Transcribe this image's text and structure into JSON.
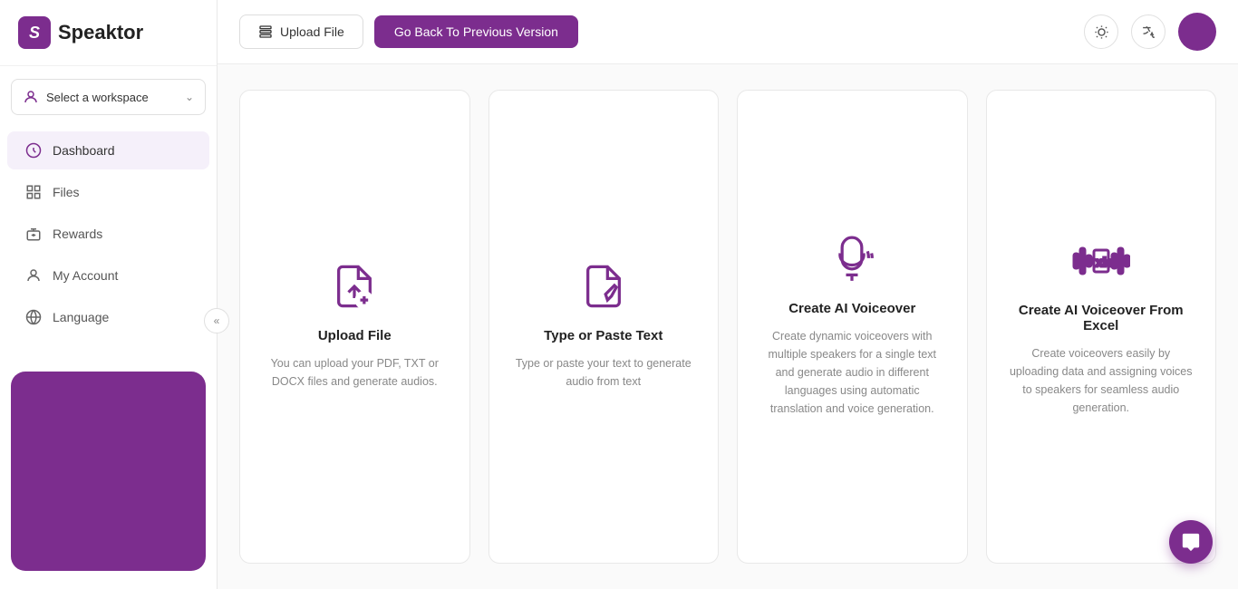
{
  "app": {
    "name": "Speaktor"
  },
  "sidebar": {
    "workspace_label": "Select a workspace",
    "nav_items": [
      {
        "id": "dashboard",
        "label": "Dashboard",
        "active": true
      },
      {
        "id": "files",
        "label": "Files",
        "active": false
      },
      {
        "id": "rewards",
        "label": "Rewards",
        "active": false
      },
      {
        "id": "my-account",
        "label": "My Account",
        "active": false
      },
      {
        "id": "language",
        "label": "Language",
        "active": false
      }
    ]
  },
  "topbar": {
    "upload_btn_label": "Upload File",
    "go_back_btn_label": "Go Back To Previous Version"
  },
  "cards": [
    {
      "id": "upload-file",
      "title": "Upload File",
      "desc": "You can upload your PDF, TXT or DOCX files and generate audios."
    },
    {
      "id": "type-paste-text",
      "title": "Type or Paste Text",
      "desc": "Type or paste your text to generate audio from text"
    },
    {
      "id": "create-ai-voiceover",
      "title": "Create AI Voiceover",
      "desc": "Create dynamic voiceovers with multiple speakers for a single text and generate audio in different languages using automatic translation and voice generation."
    },
    {
      "id": "create-ai-voiceover-excel",
      "title": "Create AI Voiceover From Excel",
      "desc": "Create voiceovers easily by uploading data and assigning voices to speakers for seamless audio generation."
    }
  ],
  "colors": {
    "brand": "#7c2d8e",
    "brand_light": "#f5f0fa"
  }
}
